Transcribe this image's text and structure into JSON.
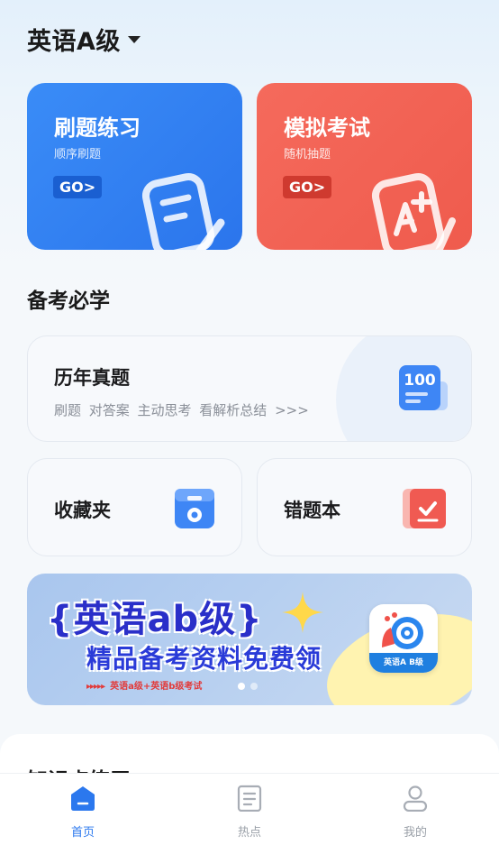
{
  "header": {
    "title": "英语A级"
  },
  "practice_card": {
    "title": "刷题练习",
    "subtitle": "顺序刷题",
    "go_label": "GO>"
  },
  "exam_card": {
    "title": "模拟考试",
    "subtitle": "随机抽题",
    "go_label": "GO>"
  },
  "section_prep": {
    "title": "备考必学"
  },
  "history_card": {
    "title": "历年真题",
    "tags": "刷题  对答案  主动思考  看解析总结 >>>",
    "icon_text": "100"
  },
  "favorites_card": {
    "title": "收藏夹"
  },
  "mistakes_card": {
    "title": "错题本"
  },
  "banner": {
    "title": "{英语ab级}",
    "subtitle": "精品备考资料免费领",
    "small_text": "英语a级+英语b级考试",
    "logo_label": "英语A B级",
    "dots": 2,
    "active_dot": 0
  },
  "section_knowledge": {
    "title": "知识点练习"
  },
  "tabbar": {
    "items": [
      {
        "label": "首页",
        "icon": "home-icon",
        "active": true
      },
      {
        "label": "热点",
        "icon": "document-icon",
        "active": false
      },
      {
        "label": "我的",
        "icon": "user-icon",
        "active": false
      }
    ]
  },
  "colors": {
    "primary": "#2b78ee",
    "practice_bg": "#3a8cf7",
    "exam_bg": "#f56a5c"
  }
}
